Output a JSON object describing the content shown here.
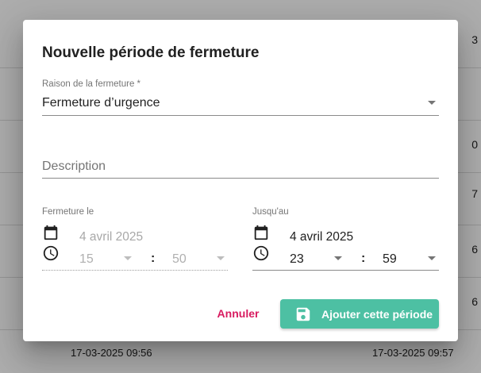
{
  "background": {
    "row_stubs": [
      "3",
      "0",
      "7",
      "6",
      "6"
    ],
    "last_row": {
      "start": "17-03-2025 09:56",
      "end": "17-03-2025 09:57"
    }
  },
  "dialog": {
    "title": "Nouvelle période de fermeture",
    "reason": {
      "label": "Raison de la fermeture *",
      "value": "Fermeture d’urgence"
    },
    "description": {
      "placeholder": "Description"
    },
    "start": {
      "label": "Fermeture le",
      "date": "4 avril 2025",
      "hour": "15",
      "minute": "50",
      "disabled": true
    },
    "end": {
      "label": "Jusqu'au",
      "date": "4 avril 2025",
      "hour": "23",
      "minute": "59"
    },
    "colon": ":",
    "cancel_label": "Annuler",
    "submit_label": "Ajouter cette période"
  },
  "colors": {
    "accent": "#4dc0a3",
    "cancel": "#d81b60"
  }
}
